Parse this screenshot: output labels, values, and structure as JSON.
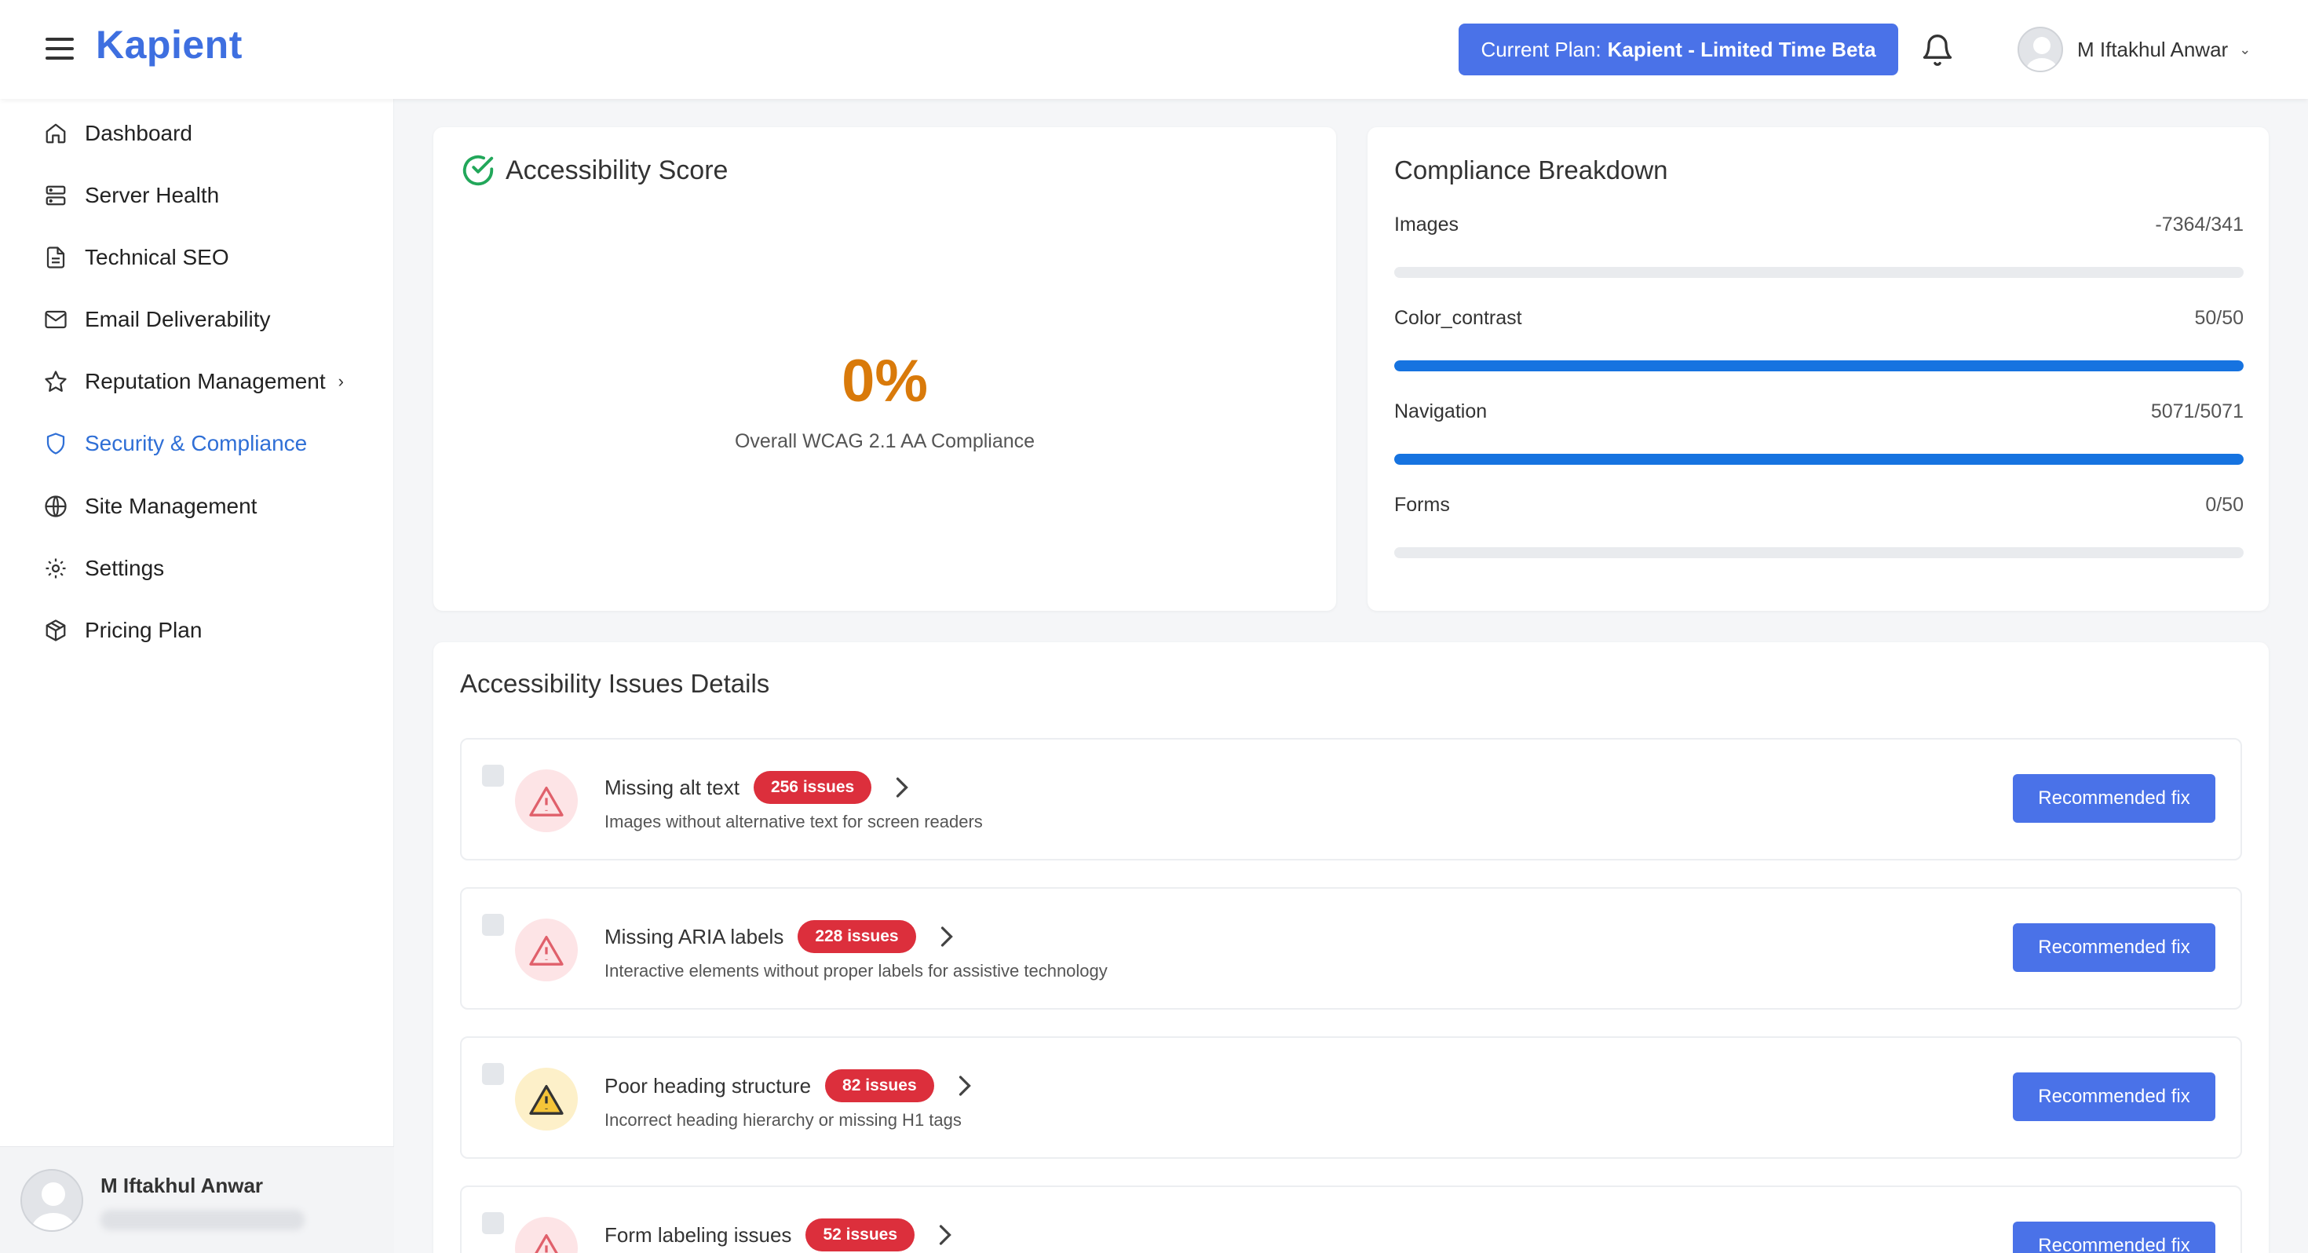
{
  "header": {
    "logo": "Kapient",
    "plan_prefix": "Current Plan:",
    "plan_name": "Kapient - Limited Time Beta",
    "user_name": "M Iftakhul Anwar"
  },
  "sidebar": {
    "items": [
      {
        "label": "Dashboard",
        "icon": "home-icon"
      },
      {
        "label": "Server Health",
        "icon": "server-icon"
      },
      {
        "label": "Technical SEO",
        "icon": "document-icon"
      },
      {
        "label": "Email Deliverability",
        "icon": "mail-icon"
      },
      {
        "label": "Reputation Management",
        "icon": "star-icon"
      },
      {
        "label": "Security & Compliance",
        "icon": "shield-icon"
      },
      {
        "label": "Site Management",
        "icon": "globe-icon"
      },
      {
        "label": "Settings",
        "icon": "gear-icon"
      },
      {
        "label": "Pricing Plan",
        "icon": "package-icon"
      }
    ],
    "active_item": "Security & Compliance",
    "footer_user_name": "M Iftakhul Anwar"
  },
  "score": {
    "title": "Accessibility Score",
    "value": "0%",
    "label": "Overall WCAG 2.1 AA Compliance"
  },
  "breakdown": {
    "title": "Compliance Breakdown",
    "rows": [
      {
        "label": "Images",
        "value": "-7364/341",
        "fraction": 0
      },
      {
        "label": "Color_contrast",
        "value": "50/50",
        "fraction": 1
      },
      {
        "label": "Navigation",
        "value": "5071/5071",
        "fraction": 1
      },
      {
        "label": "Forms",
        "value": "0/50",
        "fraction": 0
      }
    ],
    "fill_color": "#1673e0"
  },
  "issues": {
    "title": "Accessibility Issues Details",
    "fix_label": "Recommended fix",
    "items": [
      {
        "title": "Missing alt text",
        "badge": "256 issues",
        "desc": "Images without alternative text for screen readers",
        "severity": "red"
      },
      {
        "title": "Missing ARIA labels",
        "badge": "228 issues",
        "desc": "Interactive elements without proper labels for assistive technology",
        "severity": "red"
      },
      {
        "title": "Poor heading structure",
        "badge": "82 issues",
        "desc": "Incorrect heading hierarchy or missing H1 tags",
        "severity": "yellow"
      },
      {
        "title": "Form labeling issues",
        "badge": "52 issues",
        "desc": "",
        "severity": "red"
      }
    ]
  },
  "colors": {
    "brand": "#3e6fe0",
    "button": "#4a72e8",
    "score": "#d97a0a",
    "badge": "#dc2f3c",
    "active_nav": "#2f6fd6"
  }
}
